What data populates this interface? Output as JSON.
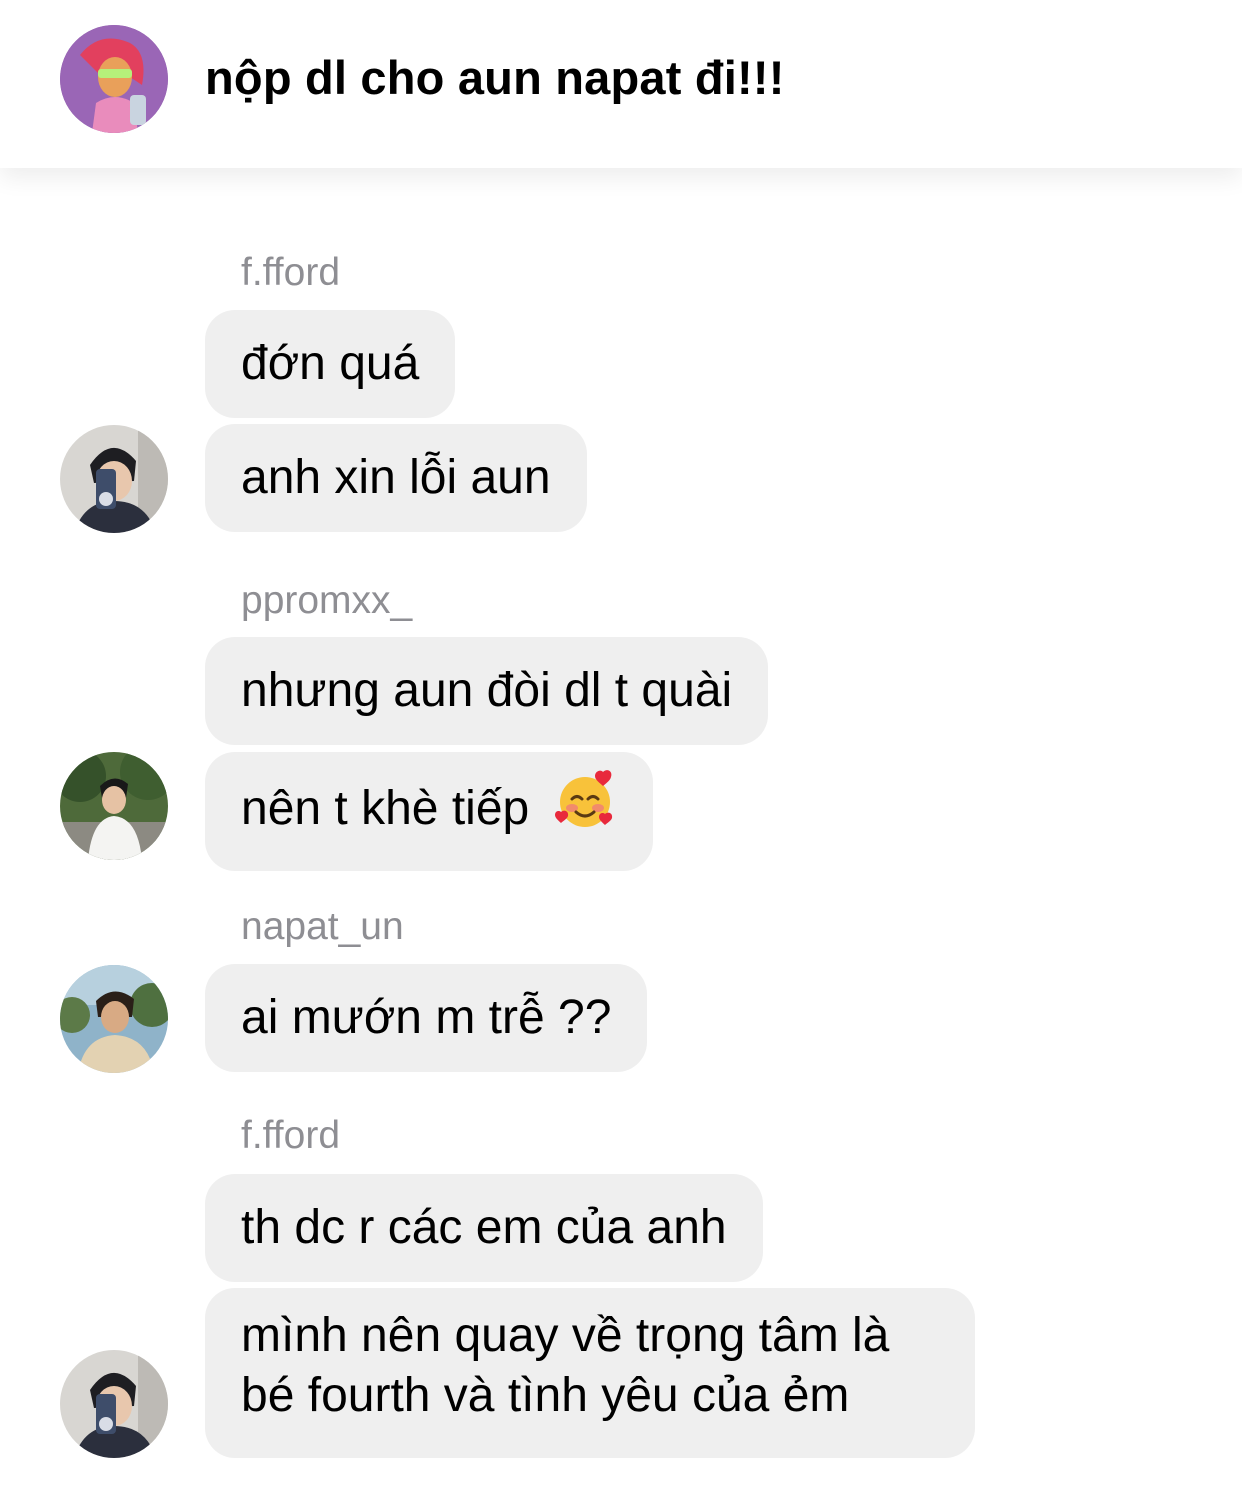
{
  "header": {
    "title": "nộp dl cho aun napat đi!!!",
    "avatar": "group-avatar"
  },
  "messages": [
    {
      "sender": "f.fford",
      "text": "đớn quá"
    },
    {
      "text": "anh xin lỗi aun"
    },
    {
      "sender": "ppromxx_",
      "text": "nhưng aun đòi dl t quài"
    },
    {
      "text": "nên t khè tiếp",
      "emoji": "smiling-face-with-hearts-icon"
    },
    {
      "sender": "napat_un",
      "text": "ai mướn m trễ ??"
    },
    {
      "sender": "f.fford",
      "text": "th dc r các em của anh"
    },
    {
      "text": "mình nên quay về trọng tâm là bé fourth và tình yêu của ẻm"
    }
  ],
  "colors": {
    "bubble": "#efefef",
    "sender": "#8e8e93",
    "background": "#ffffff"
  }
}
